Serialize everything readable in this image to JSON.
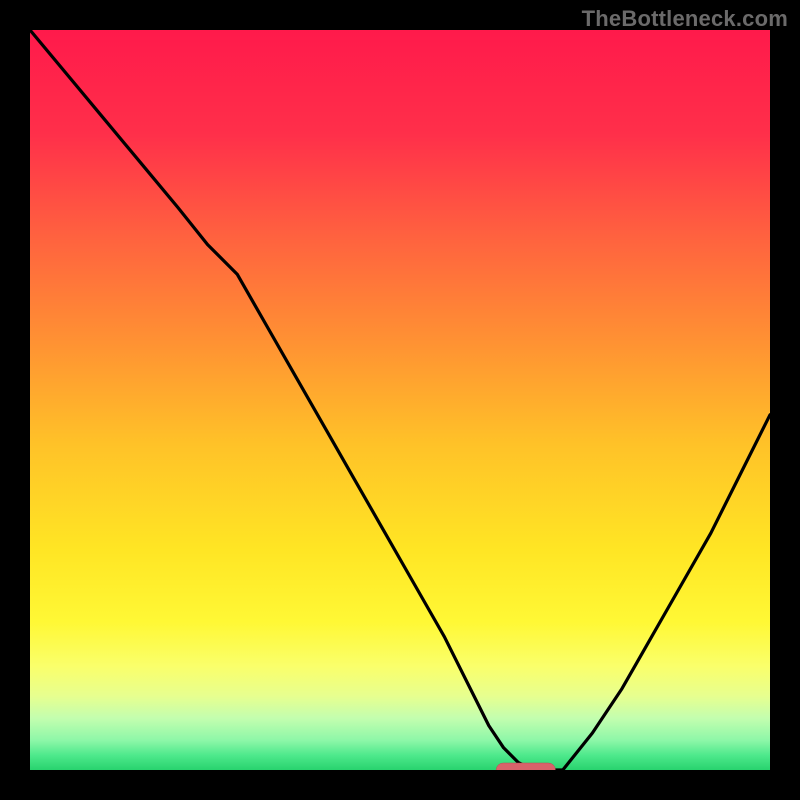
{
  "watermark": "TheBottleneck.com",
  "chart_data": {
    "type": "line",
    "title": "",
    "xlabel": "",
    "ylabel": "",
    "xlim": [
      0,
      100
    ],
    "ylim": [
      0,
      100
    ],
    "series": [
      {
        "name": "curve",
        "x": [
          0,
          5,
          10,
          15,
          20,
          24,
          28,
          32,
          36,
          40,
          44,
          48,
          52,
          56,
          60,
          62,
          64,
          66,
          68,
          70,
          72,
          76,
          80,
          84,
          88,
          92,
          96,
          100
        ],
        "y": [
          100,
          94,
          88,
          82,
          76,
          71,
          67,
          60,
          53,
          46,
          39,
          32,
          25,
          18,
          10,
          6,
          3,
          1,
          0,
          0,
          0,
          5,
          11,
          18,
          25,
          32,
          40,
          48
        ]
      }
    ],
    "marker": {
      "x_start": 63,
      "x_end": 71,
      "y": 0
    },
    "gradient_stops": [
      {
        "pct": 0,
        "color": "#ff1a4b"
      },
      {
        "pct": 14,
        "color": "#ff2f4a"
      },
      {
        "pct": 28,
        "color": "#ff623f"
      },
      {
        "pct": 42,
        "color": "#ff9133"
      },
      {
        "pct": 56,
        "color": "#ffc228"
      },
      {
        "pct": 70,
        "color": "#ffe524"
      },
      {
        "pct": 80,
        "color": "#fff835"
      },
      {
        "pct": 86,
        "color": "#faff6b"
      },
      {
        "pct": 90,
        "color": "#e7ff8f"
      },
      {
        "pct": 93,
        "color": "#c3feaf"
      },
      {
        "pct": 96,
        "color": "#8df7a8"
      },
      {
        "pct": 98,
        "color": "#4ee98c"
      },
      {
        "pct": 100,
        "color": "#28d36e"
      }
    ]
  }
}
